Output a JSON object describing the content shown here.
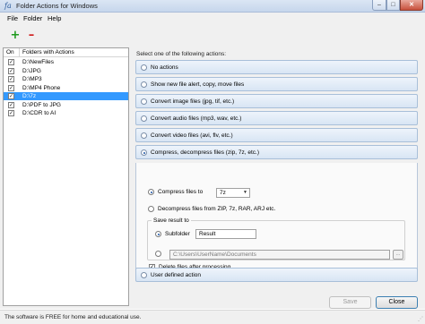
{
  "window": {
    "title": "Folder Actions for Windows",
    "icon": "app-icon",
    "minimize": "–",
    "maximize": "□",
    "close": "✕"
  },
  "menu": [
    "File",
    "Folder",
    "Help"
  ],
  "toolbar": {
    "add": "+",
    "remove": "–"
  },
  "folders": {
    "header_on": "On",
    "header_name": "Folders with Actions",
    "items": [
      {
        "name": "D:\\NewFiles",
        "checked": true,
        "selected": false
      },
      {
        "name": "D:\\JPG",
        "checked": true,
        "selected": false
      },
      {
        "name": "D:\\MP3",
        "checked": true,
        "selected": false
      },
      {
        "name": "D:\\MP4 Phone",
        "checked": true,
        "selected": false
      },
      {
        "name": "D:\\7z",
        "checked": true,
        "selected": true
      },
      {
        "name": "D:\\PDF to JPG",
        "checked": true,
        "selected": false
      },
      {
        "name": "D:\\CDR to AI",
        "checked": true,
        "selected": false
      }
    ]
  },
  "actions_prompt": "Select one of the following actions:",
  "actions": [
    {
      "label": "No actions",
      "selected": false
    },
    {
      "label": "Show new file alert, copy, move files",
      "selected": false
    },
    {
      "label": "Convert image files (jpg, tif, etc.)",
      "selected": false
    },
    {
      "label": "Convert audio files (mp3, wav, etc.)",
      "selected": false
    },
    {
      "label": "Convert video files (avi, flv, etc.)",
      "selected": false
    },
    {
      "label": "Compress, decompress files (zip, 7z, etc.)",
      "selected": true
    }
  ],
  "compress": {
    "compress_label": "Compress files to",
    "compress_format": "7z",
    "decompress_label": "Decompress files from  ZIP, 7z, RAR, ARJ etc.",
    "save_result_label": "Save result to",
    "subfolder_label": "Subfolder",
    "subfolder_value": "Result",
    "path_value": "C:\\Users\\UserName\\Documents",
    "browse_label": "...",
    "delete_label": "Delete files after processing",
    "delete_checked": true
  },
  "user_action": {
    "label": "User defined action",
    "selected": false
  },
  "buttons": {
    "save": "Save",
    "close": "Close"
  },
  "status": "The software is FREE for home and educational use."
}
